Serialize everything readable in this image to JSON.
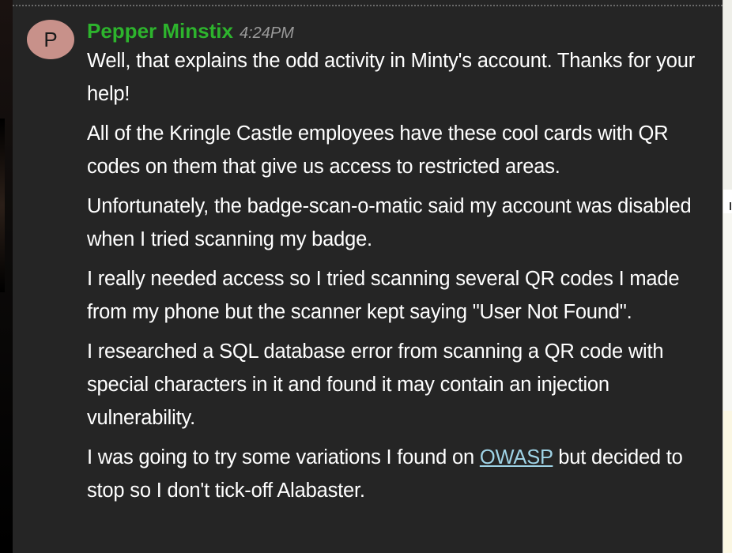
{
  "message": {
    "avatar_initial": "P",
    "author": "Pepper Minstix",
    "timestamp": "4:24PM",
    "paragraphs": [
      "Well, that explains the odd activity in Minty's account. Thanks for your help!",
      "All of the Kringle Castle employees have these cool cards with QR codes on them that give us access to restricted areas.",
      "Unfortunately, the badge-scan-o-matic said my account was disabled when I tried scanning my badge.",
      "I really needed access so I tried scanning several QR codes I made from my phone but the scanner kept saying \"User Not Found\".",
      "I researched a SQL database error from scanning a QR code with special characters in it and found it may contain an injection vulnerability."
    ],
    "last_paragraph": {
      "before_link": "I was going to try some variations I found on ",
      "link_text": "OWASP",
      "after_link": " but decided to stop so I don't tick-off Alabaster."
    }
  },
  "colors": {
    "panel_background": "#252525",
    "author": "#2db42d",
    "timestamp": "#9a9a9a",
    "link": "#9fd3e6",
    "avatar": "#c8918a"
  }
}
